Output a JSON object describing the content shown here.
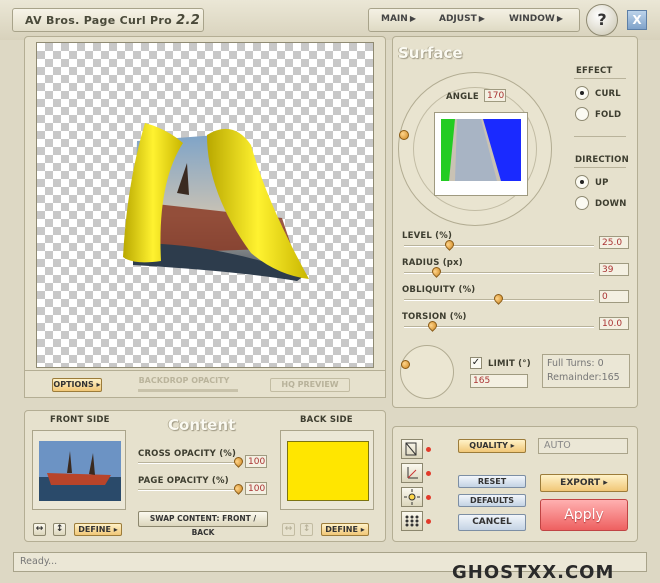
{
  "app": {
    "title": "AV Bros. Page Curl Pro",
    "version": "2.2"
  },
  "menu": {
    "main": "MAIN",
    "adjust": "ADJUST",
    "window": "WINDOW"
  },
  "window_buttons": {
    "help": "?",
    "close": "X"
  },
  "preview": {
    "options_label": "OPTIONS",
    "backdrop_opacity_label": "BACKDROP OPACITY",
    "hq_preview_label": "HQ PREVIEW"
  },
  "surface": {
    "title": "Surface",
    "angle_label": "ANGLE",
    "angle_value": "170",
    "effect_label": "EFFECT",
    "effect_options": [
      "CURL",
      "FOLD"
    ],
    "effect_selected": "CURL",
    "direction_label": "DIRECTION",
    "direction_options": [
      "UP",
      "DOWN"
    ],
    "direction_selected": "UP",
    "sliders": [
      {
        "label": "LEVEL (%)",
        "value": "25.0",
        "fraction": 0.25
      },
      {
        "label": "RADIUS (px)",
        "value": "39",
        "fraction": 0.2
      },
      {
        "label": "OBLIQUITY (%)",
        "value": "0",
        "fraction": 0.5
      },
      {
        "label": "TORSION (%)",
        "value": "10.0",
        "fraction": 0.18
      }
    ],
    "limit_label": "LIMIT (°)",
    "limit_checked": true,
    "limit_value": "165",
    "full_turns_label": "Full Turns:",
    "full_turns_value": "0",
    "remainder_label": "Remainder:",
    "remainder_value": "165"
  },
  "content": {
    "title": "Content",
    "front_side_label": "FRONT SIDE",
    "back_side_label": "BACK SIDE",
    "cross_opacity_label": "CROSS OPACITY (%)",
    "cross_opacity_value": "100",
    "page_opacity_label": "PAGE OPACITY (%)",
    "page_opacity_value": "100",
    "swap_label": "SWAP CONTENT: FRONT / BACK",
    "define_label": "DEFINE",
    "back_color": "#ffe600"
  },
  "actions": {
    "quality_label": "QUALITY",
    "quality_value": "AUTO",
    "reset_label": "RESET",
    "defaults_label": "DEFAULTS",
    "cancel_label": "CANCEL",
    "export_label": "EXPORT",
    "apply_label": "Apply"
  },
  "status": {
    "text": "Ready..."
  },
  "watermark": "GHOSTXX.COM",
  "colors": {
    "curl_yellow": "#f2e010",
    "apply_red": "#ef6f6f",
    "accent_orange": "#d08a24"
  }
}
